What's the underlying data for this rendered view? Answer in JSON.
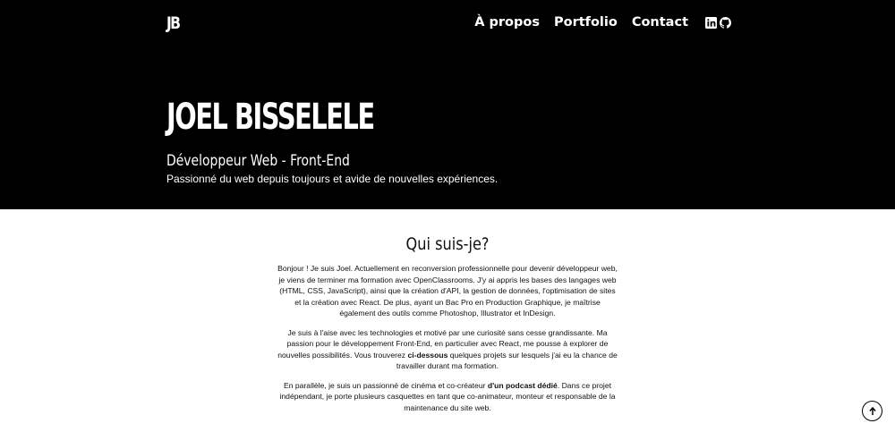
{
  "header": {
    "logo": "JB",
    "nav": [
      "À propos",
      "Portfolio",
      "Contact"
    ],
    "social_icons": [
      "linkedin-icon",
      "github-icon"
    ]
  },
  "hero": {
    "title": "JOEL BISSELELE",
    "subtitle": "Développeur Web - Front-End",
    "tagline": "Passionné du web depuis toujours et avide de nouvelles expériences."
  },
  "about": {
    "heading": "Qui suis-je?",
    "p1": "Bonjour ! Je suis Joel. Actuellement en reconversion professionnelle pour devenir développeur web, je viens de terminer ma formation avec OpenClassrooms. J'y ai appris les bases des langages web (HTML, CSS, JavaScript), ainsi que la création d'API, la gestion de données, l'optimisation de sites et la création avec React. De plus, ayant un Bac Pro en Production Graphique, je maîtrise également des outils comme Photoshop, Illustrator et InDesign.",
    "p2_before": "Je suis à l'aise avec les technologies et motivé par une curiosité sans cesse grandissante. Ma passion pour le développement Front-End, en particulier avec React, me pousse à explorer de nouvelles possibilités. Vous trouverez ",
    "p2_bold": "ci-dessous",
    "p2_after": " quelques projets sur lesquels j'ai eu la chance de travailler durant ma formation.",
    "p3_before": "En parallèle, je suis un passionné de cinéma et co-créateur ",
    "p3_bold": "d'un podcast dédié",
    "p3_after": ". Dans ce projet indépendant, je porte plusieurs casquettes en tant que co-animateur, monteur et responsable de la maintenance du site web."
  },
  "scroll_top_icon": "arrow-up-icon"
}
